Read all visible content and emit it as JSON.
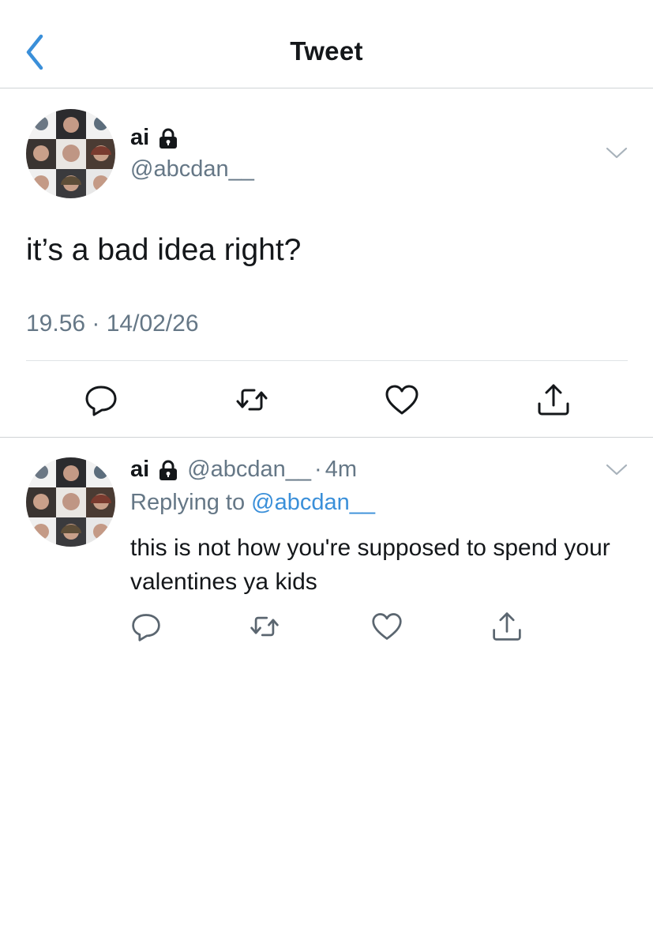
{
  "nav": {
    "title": "Tweet",
    "back_icon": "chevron-left-icon",
    "accent": "#3a8fd9"
  },
  "tweet": {
    "display_name": "ai",
    "handle": "@abcdan__",
    "protected_icon": "lock-icon",
    "text": "it’s a bad idea right?",
    "timestamp": "19.56 · 14/02/26",
    "actions": [
      "reply-icon",
      "retweet-icon",
      "like-icon",
      "share-icon"
    ]
  },
  "reply": {
    "display_name": "ai",
    "handle": "@abcdan__",
    "separator": "·",
    "age": "4m",
    "replying_prefix": "Replying to ",
    "replying_to": "@abcdan__",
    "text": "this is not how you're supposed to spend your valentines ya kids",
    "actions": [
      "reply-icon",
      "retweet-icon",
      "like-icon",
      "share-icon"
    ]
  },
  "colors": {
    "text": "#14171a",
    "muted": "#657786",
    "link": "#3a8fd9",
    "divider": "#cfd3d6"
  }
}
